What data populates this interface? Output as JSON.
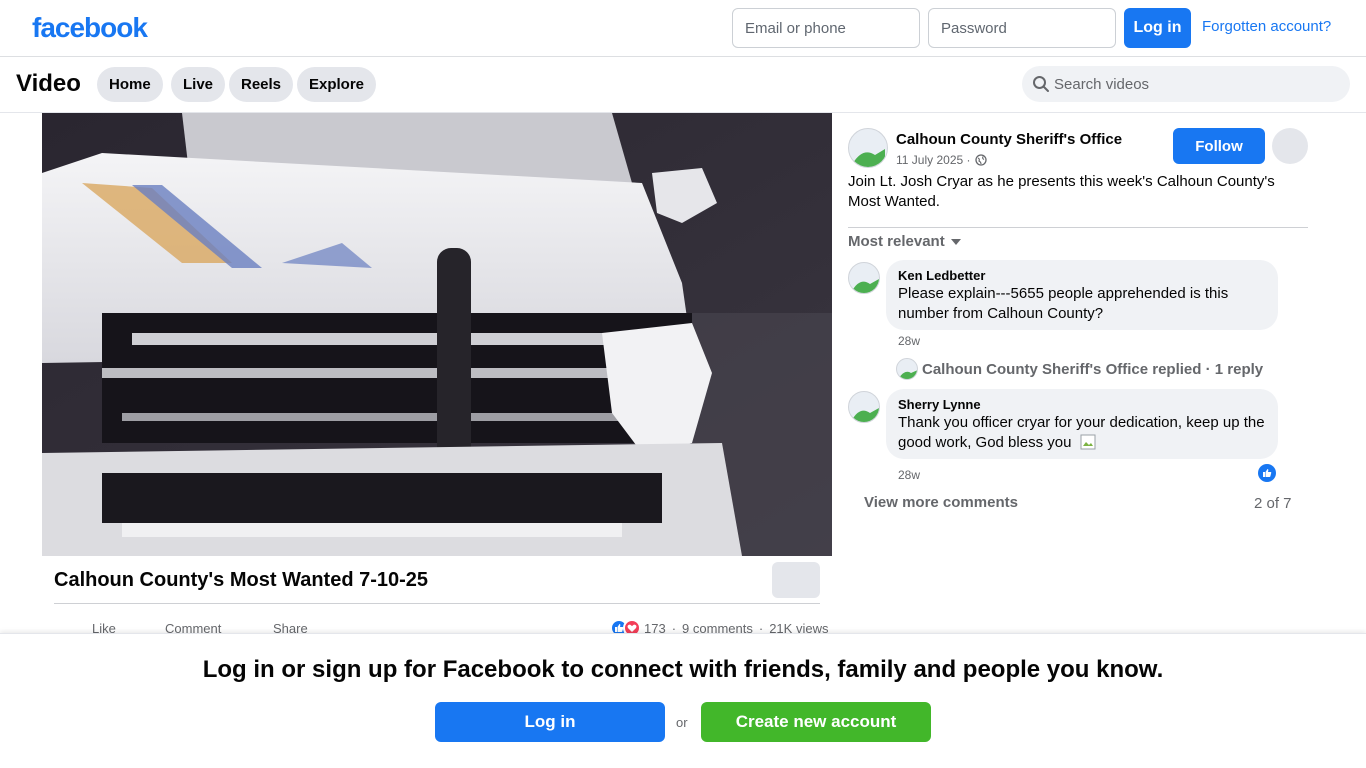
{
  "header": {
    "logo": "facebook",
    "email_placeholder": "Email or phone",
    "password_placeholder": "Password",
    "login_label": "Log in",
    "forgot_label": "Forgotten account?"
  },
  "subnav": {
    "title": "Video",
    "tabs": [
      {
        "label": "Home"
      },
      {
        "label": "Live"
      },
      {
        "label": "Reels"
      },
      {
        "label": "Explore"
      }
    ],
    "search_placeholder": "Search videos"
  },
  "video": {
    "title": "Calhoun County's Most Wanted 7-10-25",
    "actions": {
      "like": "Like",
      "comment": "Comment",
      "share": "Share"
    },
    "stats": {
      "reactions": "173",
      "comments": "9 comments",
      "views": "21K views",
      "separator": "·"
    }
  },
  "post": {
    "page_name": "Calhoun County Sheriff's Office",
    "date": "11 July 2025 ·",
    "follow_label": "Follow",
    "description": "Join Lt. Josh Cryar as he presents this week's Calhoun County's Most Wanted.",
    "sort_label": "Most relevant"
  },
  "comments": [
    {
      "author": "Ken Ledbetter",
      "text": "Please explain---5655 people apprehended is this number from Calhoun County?",
      "time": "28w",
      "reply_summary": "Calhoun County Sheriff's Office replied · 1 reply"
    },
    {
      "author": "Sherry Lynne",
      "text": "Thank you officer cryar for your dedication, keep up the good work, God bless you",
      "time": "28w"
    }
  ],
  "comments_footer": {
    "view_more": "View more comments",
    "count": "2 of 7"
  },
  "banner": {
    "text": "Log in or sign up for Facebook to connect with friends, family and people you know.",
    "login_label": "Log in",
    "or_label": "or",
    "create_label": "Create new account"
  },
  "colors": {
    "brand": "#1877f2",
    "create_green": "#42b72a",
    "secondary_text": "#65676b"
  }
}
